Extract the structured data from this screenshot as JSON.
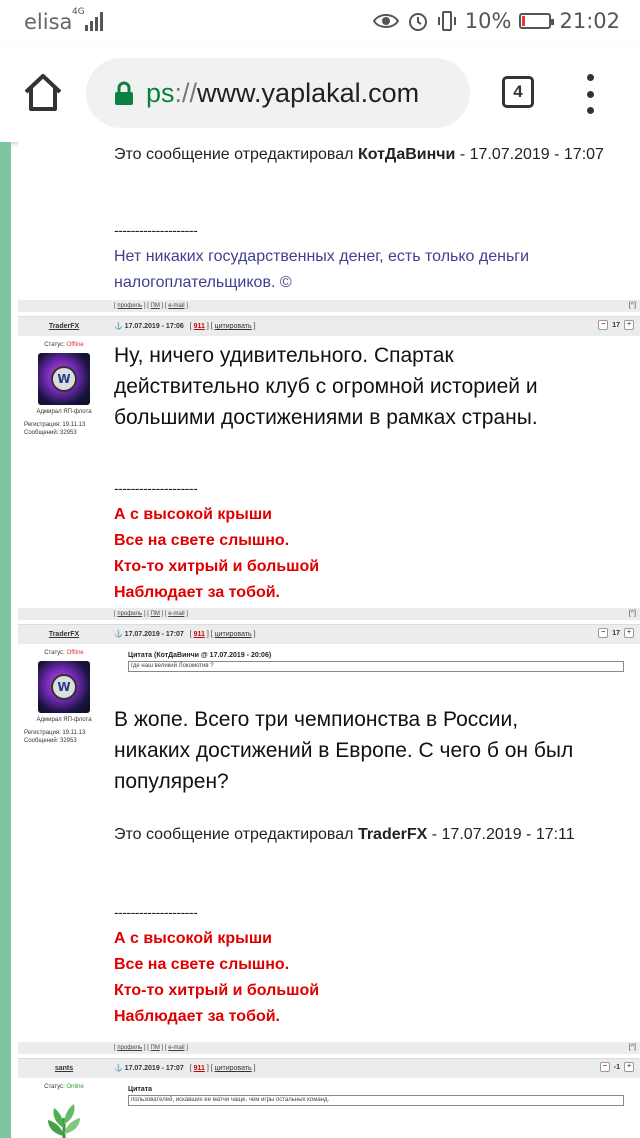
{
  "status_bar": {
    "carrier": "elisa",
    "network": "4G",
    "battery_percent": "10%",
    "time": "21:02",
    "battery_level": 0.1
  },
  "browser": {
    "url_scheme": "ps",
    "url_sep": "://",
    "url_host": "www.yaplakal.com",
    "tab_count": "4"
  },
  "post0": {
    "edited_prefix": "Это сообщение отредактировал ",
    "edited_user": "КотДаВинчи",
    "edited_suffix": " - 17.07.2019 - 17:07",
    "sig_line": "--------------------",
    "sig_text_1": "Нет никаких государственных денег, есть только деньги",
    "sig_text_2": "налогоплательщиков. ©",
    "footer": {
      "profile": "профиль",
      "pm": "ПМ",
      "email": "e-mail",
      "up": "[^]"
    }
  },
  "post1": {
    "nick": "TraderFX",
    "anchor": "⚓",
    "datetime": "17.07.2019 - 17:06",
    "num": "911",
    "quote_link": "цитировать",
    "rating": "17",
    "status_label": "Статус: ",
    "status_value": "Offline",
    "rank": "Адмирал ЯП-флота",
    "reg": "Регистрация: 19.11.13",
    "messages": "Сообщений: 32953",
    "text_1": "Ну, ничего удивительного. Спартак",
    "text_2": "действительно клуб с огромной историей и",
    "text_3": "большими достижениями в рамках страны.",
    "sig_line": "--------------------",
    "sig_1": "А с высокой крыши",
    "sig_2": "Все на свете слышно.",
    "sig_3": "Кто-то хитрый и большой",
    "sig_4": "Наблюдает за тобой.",
    "footer": {
      "profile": "профиль",
      "pm": "ПМ",
      "email": "e-mail",
      "up": "[^]"
    }
  },
  "post2": {
    "nick": "TraderFX",
    "anchor": "⚓",
    "datetime": "17.07.2019 - 17:07",
    "num": "911",
    "quote_link": "цитировать",
    "rating": "17",
    "status_label": "Статус: ",
    "status_value": "Offline",
    "rank": "Адмирал ЯП-флота",
    "reg": "Регистрация: 19.11.13",
    "messages": "Сообщений: 32953",
    "quote_header": "Цитата (КотДаВинчи @ 17.07.2019 - 20:06)",
    "quote_text": "где наш великий Локомотив ?",
    "text_1": "В жопе. Всего три чемпионства в России,",
    "text_2": "никаких достижений в Европе. С чего б он был",
    "text_3": "популярен?",
    "edited_prefix": "Это сообщение отредактировал ",
    "edited_user": "TraderFX",
    "edited_suffix": " - 17.07.2019 - 17:11",
    "sig_line": "--------------------",
    "sig_1": "А с высокой крыши",
    "sig_2": "Все на свете слышно.",
    "sig_3": "Кто-то хитрый и большой",
    "sig_4": "Наблюдает за тобой.",
    "footer": {
      "profile": "профиль",
      "pm": "ПМ",
      "email": "e-mail",
      "up": "[^]"
    }
  },
  "post3": {
    "nick": "sants",
    "anchor": "⚓",
    "datetime": "17.07.2019 - 17:07",
    "num": "911",
    "quote_link": "цитировать",
    "rating": "-1",
    "status_label": "Статус: ",
    "status_value": "Online",
    "quote_header": "Цитата",
    "quote_text": "пользователей, искавших ее матчи чаще, чем игры остальных команд."
  }
}
